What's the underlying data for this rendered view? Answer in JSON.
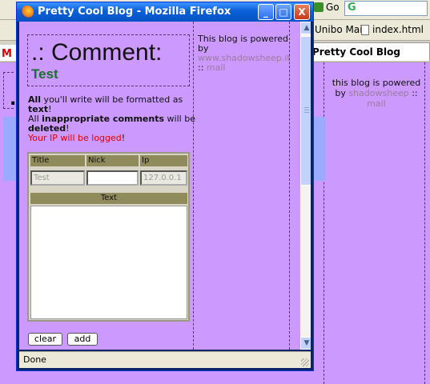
{
  "background_browser": {
    "go_label": "Go",
    "search_engine": "G",
    "bookmarks": [
      "Unibo Mail",
      "index.html"
    ],
    "tab_title": "Pretty Cool Blog",
    "left_tab_glyph": "M",
    "page_dot": ".",
    "sidebar_powered": {
      "text": "this blog is powered by",
      "link": "shadowsheep",
      "sep": "::",
      "link2": "mail"
    }
  },
  "window": {
    "title": "Pretty Cool Blog - Mozilla Firefox",
    "buttons": {
      "minimize": "_",
      "maximize": "□",
      "close": "X"
    },
    "status": "Done"
  },
  "content": {
    "heading": ".: Comment:",
    "subheading": "Test",
    "powered": {
      "text": "This blog is powered by",
      "link": "www.shadowsheep.it",
      "sep": "::",
      "link2": "mail"
    },
    "notes": {
      "line1_bold": "All",
      "line1_rest": " you'll write will be formatted as ",
      "line1_bold2": "text",
      "line1_end": "!",
      "line2_start": "All ",
      "line2_bold": "inappropriate comments",
      "line2_mid": " will be ",
      "line2_bold2": "deleted",
      "line2_end": "!",
      "line3_red": "Your IP will be logged",
      "line3_end": "!"
    },
    "form": {
      "headers": {
        "title": "Title",
        "nick": "Nick",
        "ip": "Ip"
      },
      "values": {
        "title": "Test",
        "nick": "",
        "ip": "127.0.0.1"
      },
      "text_header": "Text",
      "text_value": "",
      "buttons": {
        "clear": "clear",
        "add": "add"
      }
    }
  },
  "colors": {
    "page_bg": "#cc99ff",
    "heading_green": "#1a6e2e",
    "warning_red": "#e00000",
    "link": "#9c7c9c"
  }
}
